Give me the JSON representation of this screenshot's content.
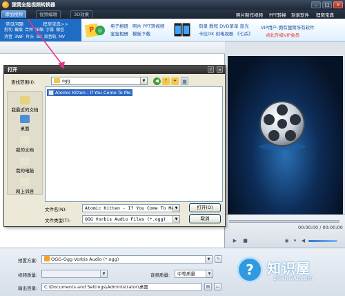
{
  "window": {
    "title": "狸窝全能视频转换器",
    "buttons": [
      "–",
      "□",
      "×"
    ]
  },
  "menu": {
    "tabs": [
      "添加视频",
      "视频编辑",
      "3D效果"
    ],
    "active_tab": 0,
    "top_links": [
      "照片制作视频",
      "PPT转换",
      "刻录软件",
      "狸窝宝典"
    ]
  },
  "banner": {
    "help_title": "常见问题",
    "help_more": "狸窝宝典>>",
    "help_links": [
      "剪切",
      "截取",
      "合并",
      "压缩",
      "字幕",
      "微信",
      "消音",
      "3WF",
      "片头",
      "3D",
      "双音轨",
      "MV"
    ],
    "ad_col1": [
      "电子相册",
      "宝宝相册"
    ],
    "ad_col2": [
      "照片",
      "PPT转视频",
      "模板下载"
    ],
    "ad_col3": [
      "刻录",
      "教程",
      "DVD菜单",
      "蓝光"
    ],
    "ad_col4": [
      "卡拉OK",
      "刻电视剧",
      "《七杀》"
    ],
    "vip_text": "VIP用户-拥有狸窝所有软件",
    "vip_link": "点此升级VIP会员",
    "colors": {
      "help_bg": "#1f6cc4",
      "vip_link": "#e8311a"
    }
  },
  "dialog": {
    "title": "打开",
    "help_btn": "?",
    "close_btn": "×",
    "look_in_label": "查找范围(I):",
    "look_in_value": "ogg",
    "places": [
      "我最近的文档",
      "桌面",
      "我的文档",
      "我的电脑",
      "网上邻居"
    ],
    "files": [
      "Atomic Kitten - If You Come To Me"
    ],
    "filename_label": "文件名(N):",
    "filename_value": "Atomic Kitten - If You Come To Me",
    "filetype_label": "文件类型(T):",
    "filetype_value": "OGG Vorbis Audio Files (*.ogg)",
    "open_btn": "打开(O)",
    "cancel_btn": "取消"
  },
  "player": {
    "time": "00:00:00 / 00:00:00",
    "progress": 0
  },
  "settings": {
    "preset_label": "预置方案:",
    "preset_value": "OGG-Ogg Vorbis Audio (*.ogg)",
    "video_quality_label": "视频质量:",
    "video_quality_value": "",
    "audio_quality_label": "音频质量:",
    "audio_quality_value": "中等质量",
    "output_label": "输出目录:",
    "output_value": "C:\\Documents and Settings\\Administrator\\桌面"
  },
  "watermark": {
    "main": "知识屋",
    "sub": "zhishiwu.com"
  },
  "annotation": {
    "color": "#e0358a"
  }
}
